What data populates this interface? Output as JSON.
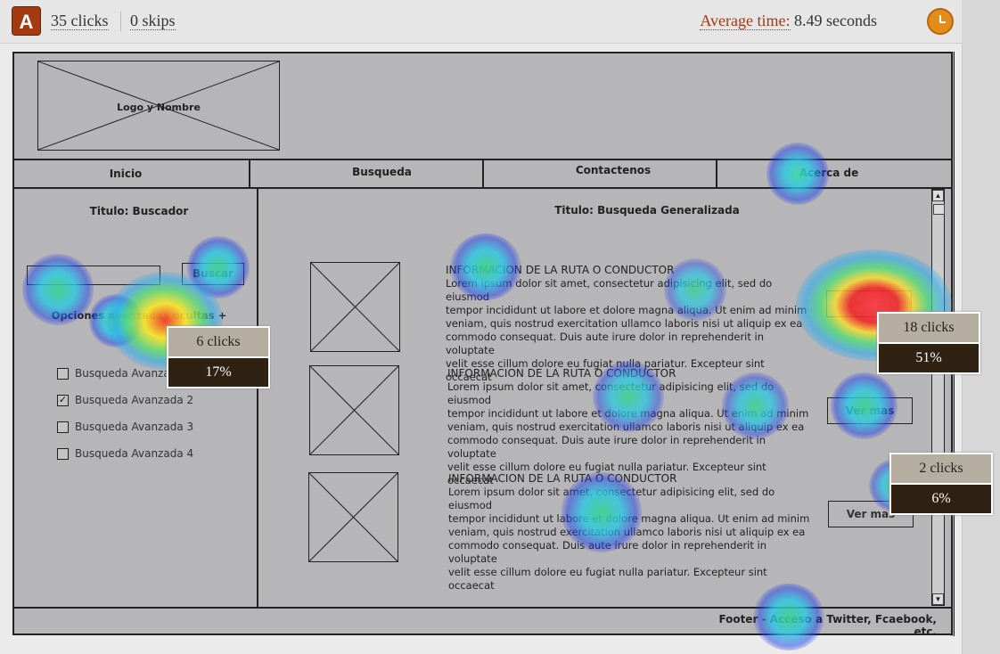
{
  "header": {
    "variant": "A",
    "clicks": "35 clicks",
    "skips": "0 skips",
    "avg_label": "Average time:",
    "avg_value": "8.49 seconds"
  },
  "wireframe": {
    "logo": "Logo y Nombre",
    "nav": [
      "Inicio",
      "Busqueda",
      "Contactenos",
      "Acerca de"
    ],
    "sidebar_title": "Titulo: Buscador",
    "search_button": "Buscar",
    "advanced_link": "Opciones avanzadas ocultas +",
    "checkboxes": [
      {
        "label": "Busqueda Avanzada 1",
        "checked": false
      },
      {
        "label": "Busqueda Avanzada 2",
        "checked": true
      },
      {
        "label": "Busqueda Avanzada 3",
        "checked": false
      },
      {
        "label": "Busqueda Avanzada 4",
        "checked": false
      }
    ],
    "main_title": "Titulo: Busqueda Generalizada",
    "results": [
      {
        "heading": "INFORMACION DE LA RUTA O CONDUCTOR",
        "body": "Lorem ipsum dolor sit amet, consectetur adipisicing elit, sed do eiusmod\ntempor incididunt ut labore et dolore magna aliqua. Ut enim ad minim\nveniam, quis nostrud exercitation ullamco laboris nisi ut aliquip ex ea\ncommodo consequat. Duis aute irure dolor in reprehenderit in voluptate\nvelit esse cillum dolore eu fugiat nulla pariatur. Excepteur sint occaecat",
        "button": "Ver mas"
      },
      {
        "heading": "INFORMACION DE LA RUTA O CONDUCTOR",
        "body": "Lorem ipsum dolor sit amet, consectetur adipisicing elit, sed do eiusmod\ntempor incididunt ut labore et dolore magna aliqua. Ut enim ad minim\nveniam, quis nostrud exercitation ullamco laboris nisi ut aliquip ex ea\ncommodo consequat. Duis aute irure dolor in reprehenderit in voluptate\nvelit esse cillum dolore eu fugiat nulla pariatur. Excepteur sint occaecat",
        "button": "Ver mas"
      },
      {
        "heading": "INFORMACION DE LA RUTA O CONDUCTOR",
        "body": "Lorem ipsum dolor sit amet, consectetur adipisicing elit, sed do eiusmod\ntempor incididunt ut labore et dolore magna aliqua. Ut enim ad minim\nveniam, quis nostrud exercitation ullamco laboris nisi ut aliquip ex ea\ncommodo consequat. Duis aute irure dolor in reprehenderit in voluptate\nvelit esse cillum dolore eu fugiat nulla pariatur. Excepteur sint occaecat",
        "button": "Ver mas"
      }
    ],
    "footer": "Footer - Acceso a Twitter, Fcaebook, etc."
  },
  "tooltips": [
    {
      "clicks": "6 clicks",
      "percent": "17%"
    },
    {
      "clicks": "18 clicks",
      "percent": "51%"
    },
    {
      "clicks": "2 clicks",
      "percent": "6%"
    }
  ],
  "colors": {
    "accent": "#a33a12",
    "clock": "#e28c19",
    "tooltip_dark": "#2f2212",
    "tooltip_light": "#b5ada0"
  }
}
